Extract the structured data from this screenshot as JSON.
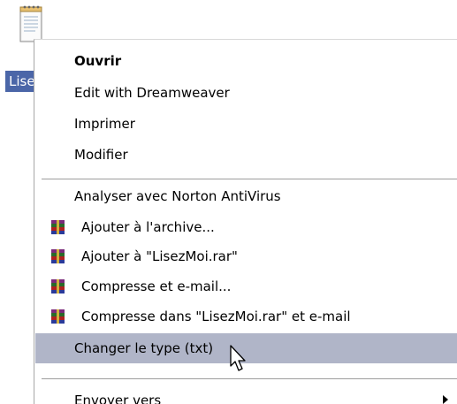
{
  "file": {
    "label": "Lisez",
    "icon": "notepad-text-file-icon"
  },
  "menu": {
    "items": [
      {
        "label": "Ouvrir",
        "default": true
      },
      {
        "label": "Edit with Dreamweaver"
      },
      {
        "label": "Imprimer"
      },
      {
        "label": "Modifier"
      },
      {
        "label": "Analyser avec Norton AntiVirus"
      },
      {
        "label": "Ajouter à l'archive...",
        "icon": "winrar-icon"
      },
      {
        "label": "Ajouter à \"LisezMoi.rar\"",
        "icon": "winrar-icon"
      },
      {
        "label": "Compresse et e-mail...",
        "icon": "winrar-icon"
      },
      {
        "label": "Compresse dans \"LisezMoi.rar\" et e-mail",
        "icon": "winrar-icon"
      },
      {
        "label": "Changer le type (txt)",
        "highlighted": true
      },
      {
        "label": "Envoyer vers",
        "submenu": true
      }
    ]
  },
  "colors": {
    "selection_bg": "#4b66a8",
    "menu_highlight": "#b0b5c8",
    "separator": "#9d9d9d"
  }
}
